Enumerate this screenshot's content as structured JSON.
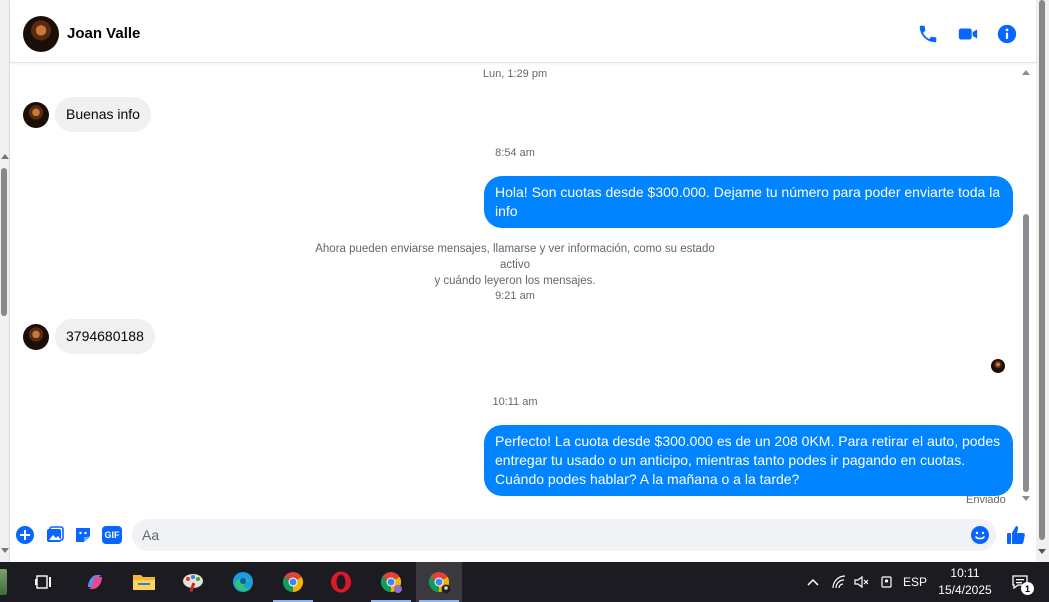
{
  "conversation": {
    "contact_name": "Joan Valle",
    "header_actions": [
      "phone-icon",
      "video-camera-icon",
      "info-icon"
    ]
  },
  "messages": {
    "ts1": "Lun, 1:29 pm",
    "in1": "Buenas info",
    "ts2": "8:54 am",
    "out1": "Hola! Son cuotas desde $300.000. Dejame tu número para poder enviarte toda la info",
    "notice_line1": "Ahora pueden enviarse mensajes, llamarse y ver información, como su estado activo",
    "notice_line2": "y cuándo leyeron los mensajes.",
    "ts3": "9:21 am",
    "in2": "3794680188",
    "ts4": "10:11 am",
    "out2": "Perfecto! La cuota desde $300.000 es de un 208 0KM. Para retirar el auto, podes entregar tu usado o un anticipo, mientras tanto podes ir pagando en cuotas. Cuándo podes hablar? A la mañana o a la tarde?",
    "status": "Enviado"
  },
  "composer": {
    "placeholder": "Aa",
    "value": "",
    "actions": [
      "add-icon",
      "photo-icon",
      "sticker-icon",
      "gif-icon",
      "emoji-icon",
      "like-icon"
    ],
    "gif_label": "GIF"
  },
  "taskbar": {
    "apps": [
      "start-icon",
      "task-view-icon",
      "copilot-icon",
      "file-explorer-icon",
      "paint-icon",
      "edge-icon",
      "chrome-icon",
      "opera-icon",
      "chrome-profile-icon",
      "chrome-profile-2-icon"
    ],
    "language": "ESP",
    "time": "10:11",
    "date": "15/4/2025",
    "notification_count": "1"
  },
  "colors": {
    "accent": "#0084ff",
    "icon_blue": "#0866ff",
    "incoming_bubble": "#f0f0f0",
    "taskbar": "#1c1b22"
  }
}
